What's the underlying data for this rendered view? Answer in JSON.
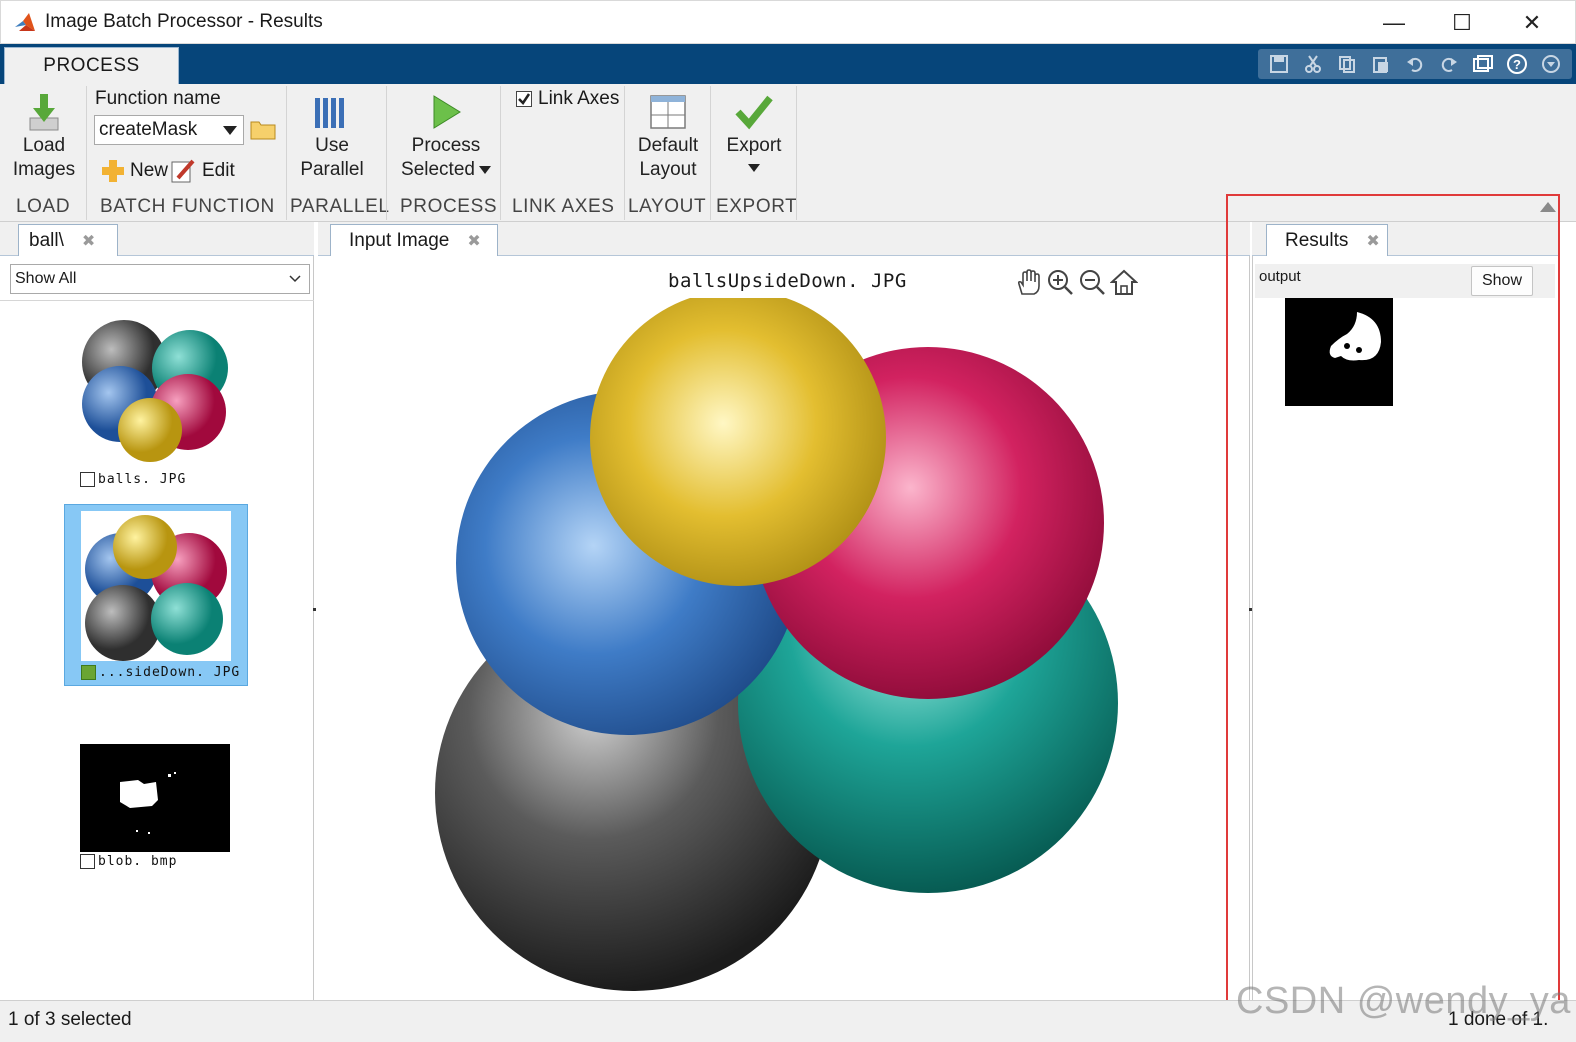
{
  "window": {
    "title": "Image Batch Processor - Results",
    "controls": {
      "minimize": "—",
      "maximize": "☐",
      "close": "✕"
    }
  },
  "ribbon": {
    "tab": "PROCESS",
    "load": {
      "line1": "Load",
      "line2": "Images",
      "section": "LOAD"
    },
    "batch_function": {
      "field_label": "Function name",
      "value": "createMask",
      "new_label": "New",
      "edit_label": "Edit",
      "section": "BATCH FUNCTION"
    },
    "parallel": {
      "line1": "Use",
      "line2": "Parallel",
      "section": "PARALLEL"
    },
    "process": {
      "line1": "Process",
      "line2": "Selected",
      "section": "PROCESS"
    },
    "link_axes": {
      "label": "Link Axes",
      "checked": true,
      "section": "LINK AXES"
    },
    "layout": {
      "line1": "Default",
      "line2": "Layout",
      "section": "LAYOUT"
    },
    "export": {
      "line1": "Export",
      "section": "EXPORT"
    }
  },
  "left_panel": {
    "tab": "ball\\",
    "filter": "Show All",
    "items": [
      {
        "label": "balls. JPG",
        "selected": false
      },
      {
        "label": "...sideDown. JPG",
        "selected": true
      },
      {
        "label": "blob. bmp",
        "selected": false
      }
    ]
  },
  "center_panel": {
    "tab": "Input Image",
    "image_title": "ballsUpsideDown. JPG"
  },
  "right_panel": {
    "tab": "Results",
    "field_name": "output",
    "show_button": "Show"
  },
  "status": {
    "left": "1 of 3 selected",
    "right": "1 done of 1."
  },
  "watermark": "CSDN @wendy_ya",
  "colors": {
    "ribbon_tab_strip": "#06457a",
    "selection_highlight": "#87c8f5",
    "annotation_box": "#e03a3a",
    "processed_badge": "#6aa533"
  }
}
